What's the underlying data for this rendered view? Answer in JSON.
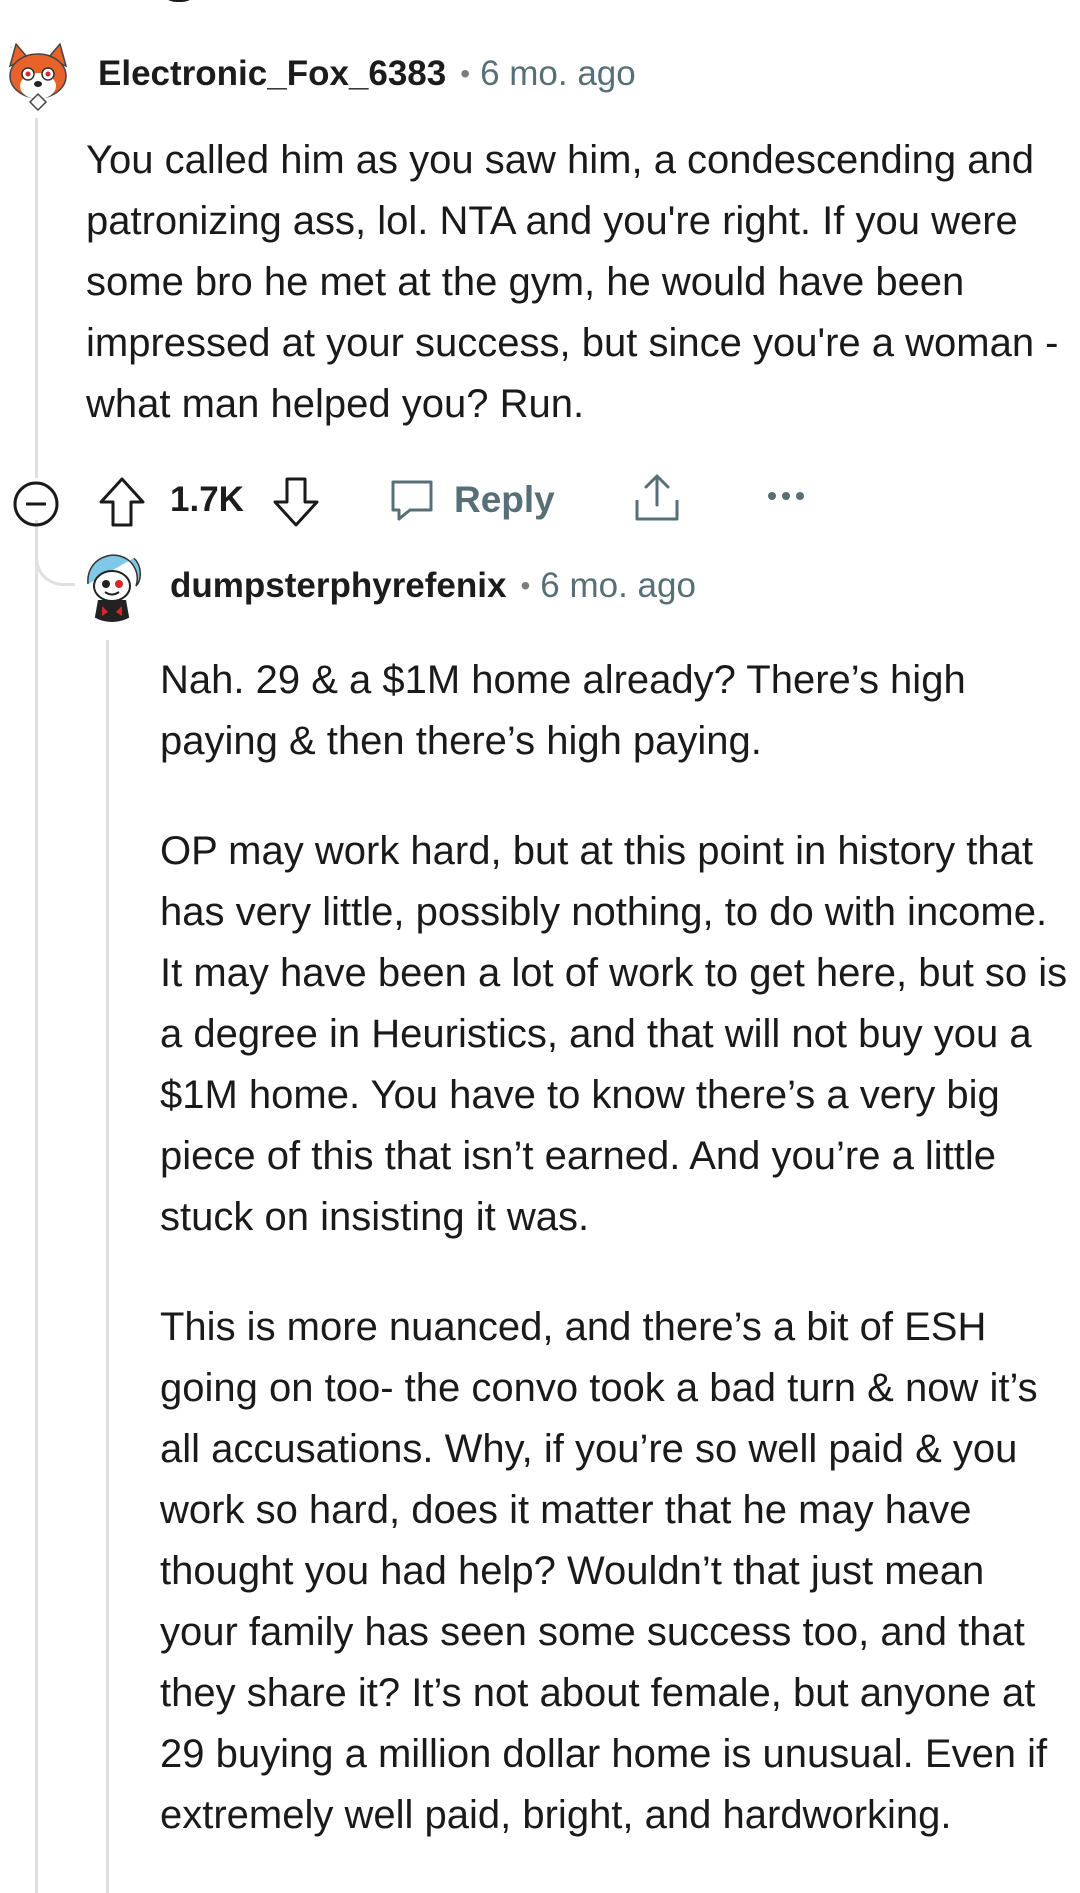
{
  "comments": [
    {
      "username": "Electronic_Fox_6383",
      "separator": "•",
      "timestamp": "6 mo. ago",
      "avatar_icon": "fox-avatar-icon",
      "body": [
        "You called him as you saw him, a condescending and patronizing ass, lol. NTA and you're right. If you were some bro he met at the gym, he would have been impressed at your success, but since you're a woman - what man helped you? Run."
      ],
      "actions": {
        "collapse_icon": "collapse-circle-minus-icon",
        "upvote_icon": "upvote-arrow-icon",
        "score": "1.7K",
        "downvote_icon": "downvote-arrow-icon",
        "reply_label": "Reply",
        "reply_icon": "speech-bubble-icon",
        "share_icon": "share-upload-icon",
        "more_icon": "more-dots-icon"
      }
    },
    {
      "username": "dumpsterphyrefenix",
      "separator": "•",
      "timestamp": "6 mo. ago",
      "avatar_icon": "snoo-avatar-icon",
      "body": [
        "Nah. 29 & a $1M home already? There’s high paying & then there’s high paying.",
        "OP may work hard, but at this point in history that has very little, possibly nothing, to do with income. It may have been a lot of work to get here, but so is a degree in Heuristics, and that will not buy you a $1M home. You have to know there’s a very big piece of this that isn’t earned. And you’re a little stuck on insisting it was.",
        "This is more nuanced, and there’s a bit of ESH going on too- the convo took a bad turn & now it’s all accusations. Why, if you’re so well paid & you work so hard, does it matter that he may have thought you had help? Wouldn’t that just mean your family has seen some success too, and that they share it? It’s not about female, but anyone at 29 buying a million dollar home is unusual. Even if extremely well paid, bright, and hardworking."
      ]
    }
  ],
  "colors": {
    "text": "#1a1a1b",
    "meta": "#576f76",
    "thread_line": "#e0e0e0",
    "fox_orange": "#e8622a"
  }
}
